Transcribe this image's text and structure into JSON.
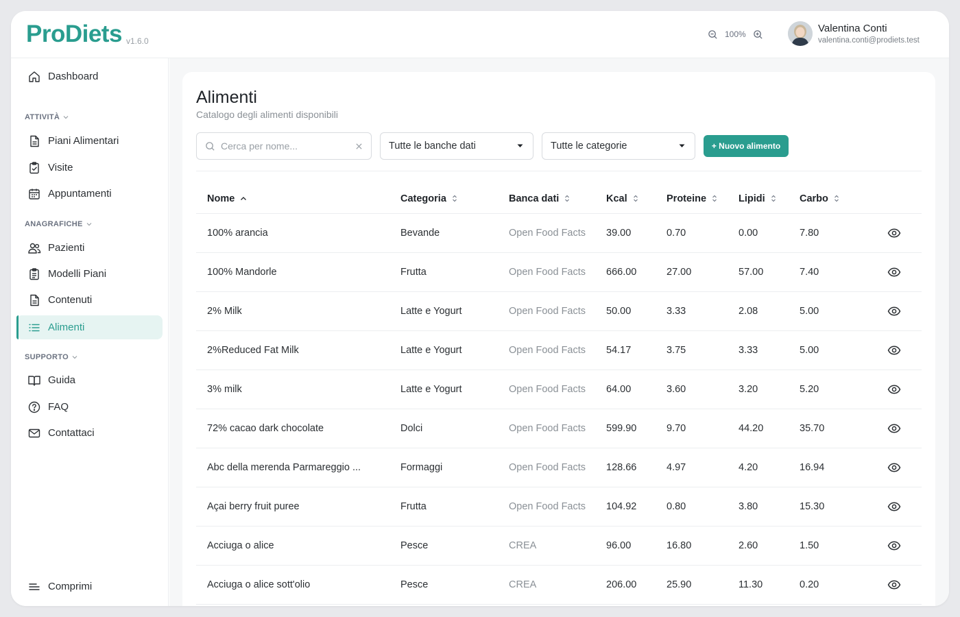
{
  "app": {
    "logo": "ProDiets",
    "version": "v1.6.0"
  },
  "header": {
    "zoom_level": "100%",
    "user_name": "Valentina Conti",
    "user_email": "valentina.conti@prodiets.test"
  },
  "sidebar": {
    "dashboard": "Dashboard",
    "sections": {
      "attivita": "ATTIVITÀ",
      "anagrafiche": "ANAGRAFICHE",
      "supporto": "SUPPORTO"
    },
    "items": {
      "piani_alimentari": "Piani Alimentari",
      "visite": "Visite",
      "appuntamenti": "Appuntamenti",
      "pazienti": "Pazienti",
      "modelli_piani": "Modelli Piani",
      "contenuti": "Contenuti",
      "alimenti": "Alimenti",
      "guida": "Guida",
      "faq": "FAQ",
      "contattaci": "Contattaci"
    },
    "collapse": "Comprimi"
  },
  "page": {
    "title": "Alimenti",
    "subtitle": "Catalogo degli alimenti disponibili"
  },
  "filters": {
    "search_placeholder": "Cerca per nome...",
    "database_select": "Tutte le banche dati",
    "category_select": "Tutte le categorie",
    "new_button": "+ Nuovo alimento"
  },
  "table": {
    "headers": {
      "nome": "Nome",
      "categoria": "Categoria",
      "banca_dati": "Banca dati",
      "kcal": "Kcal",
      "proteine": "Proteine",
      "lipidi": "Lipidi",
      "carbo": "Carbo"
    },
    "rows": [
      {
        "nome": "100% arancia",
        "categoria": "Bevande",
        "db": "Open Food Facts",
        "kcal": "39.00",
        "prot": "0.70",
        "lip": "0.00",
        "carb": "7.80"
      },
      {
        "nome": "100% Mandorle",
        "categoria": "Frutta",
        "db": "Open Food Facts",
        "kcal": "666.00",
        "prot": "27.00",
        "lip": "57.00",
        "carb": "7.40"
      },
      {
        "nome": "2% Milk",
        "categoria": "Latte e Yogurt",
        "db": "Open Food Facts",
        "kcal": "50.00",
        "prot": "3.33",
        "lip": "2.08",
        "carb": "5.00"
      },
      {
        "nome": "2%Reduced Fat Milk",
        "categoria": "Latte e Yogurt",
        "db": "Open Food Facts",
        "kcal": "54.17",
        "prot": "3.75",
        "lip": "3.33",
        "carb": "5.00"
      },
      {
        "nome": "3% milk",
        "categoria": "Latte e Yogurt",
        "db": "Open Food Facts",
        "kcal": "64.00",
        "prot": "3.60",
        "lip": "3.20",
        "carb": "5.20"
      },
      {
        "nome": "72% cacao dark chocolate",
        "categoria": "Dolci",
        "db": "Open Food Facts",
        "kcal": "599.90",
        "prot": "9.70",
        "lip": "44.20",
        "carb": "35.70"
      },
      {
        "nome": "Abc della merenda Parmareggio ...",
        "categoria": "Formaggi",
        "db": "Open Food Facts",
        "kcal": "128.66",
        "prot": "4.97",
        "lip": "4.20",
        "carb": "16.94"
      },
      {
        "nome": "Açai berry fruit puree",
        "categoria": "Frutta",
        "db": "Open Food Facts",
        "kcal": "104.92",
        "prot": "0.80",
        "lip": "3.80",
        "carb": "15.30"
      },
      {
        "nome": "Acciuga o alice",
        "categoria": "Pesce",
        "db": "CREA",
        "kcal": "96.00",
        "prot": "16.80",
        "lip": "2.60",
        "carb": "1.50"
      },
      {
        "nome": "Acciuga o alice sott'olio",
        "categoria": "Pesce",
        "db": "CREA",
        "kcal": "206.00",
        "prot": "25.90",
        "lip": "11.30",
        "carb": "0.20"
      }
    ]
  },
  "colors": {
    "brand": "#2a9d8f",
    "active_bg": "#e6f4f2"
  }
}
